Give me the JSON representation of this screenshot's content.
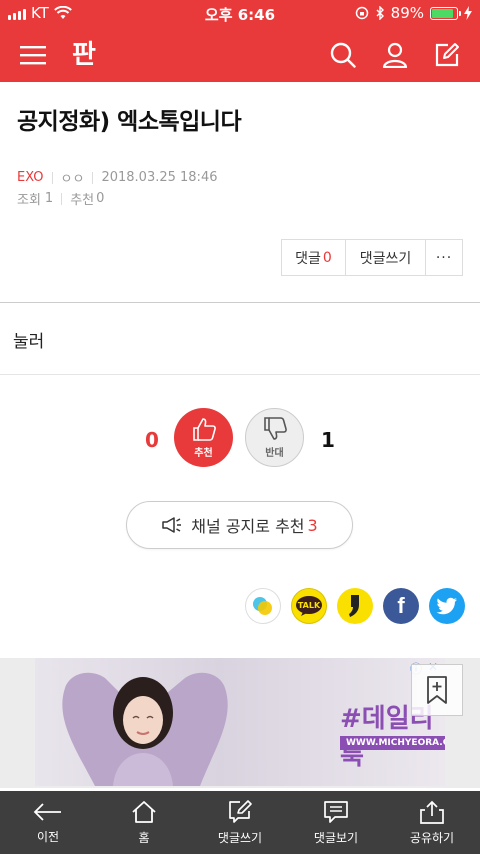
{
  "status_bar": {
    "carrier": "KT",
    "time": "오후 6:46",
    "battery_percent": "89%",
    "battery_level": 0.89
  },
  "header": {
    "logo_text": "판",
    "icons": [
      "menu-icon",
      "search-icon",
      "user-icon",
      "edit-icon"
    ]
  },
  "article": {
    "title": "공지정화) 엑소톡입니다",
    "channel": "EXO",
    "author": "ㅇㅇ",
    "date": "2018.03.25 18:46",
    "views_label": "조회",
    "views": "1",
    "recommend_label": "추천",
    "recommend_count": "0",
    "body": "눌러"
  },
  "actions": {
    "comment_label": "댓글",
    "comment_count": "0",
    "write_comment_label": "댓글쓰기",
    "more_label": "···"
  },
  "vote": {
    "up_count": "0",
    "up_label": "추천",
    "down_count": "1",
    "down_label": "반대"
  },
  "channel_recommend": {
    "label": "채널 공지로 추천",
    "count": "3"
  },
  "share": {
    "talk_label": "TALK",
    "fb_label": "f",
    "colors": {
      "kakao": "#f9e000",
      "facebook": "#3b5998",
      "twitter": "#1da1f2"
    }
  },
  "ad": {
    "hashtag": "#데일리룩",
    "url": "WWW.MICHYEORA.COM"
  },
  "bottom_nav": [
    {
      "label": "이전",
      "icon": "arrow-left-icon"
    },
    {
      "label": "홈",
      "icon": "home-icon"
    },
    {
      "label": "댓글쓰기",
      "icon": "write-comment-icon"
    },
    {
      "label": "댓글보기",
      "icon": "view-comment-icon"
    },
    {
      "label": "공유하기",
      "icon": "share-icon"
    }
  ],
  "colors": {
    "brand": "#e83a3a",
    "nav_bg": "#3e3e3e"
  }
}
